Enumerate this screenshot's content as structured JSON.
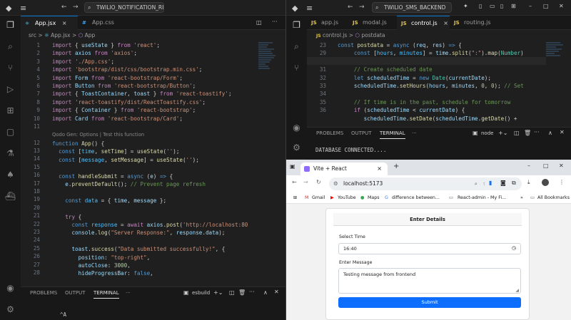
{
  "left_window": {
    "search": "TWILIO_NOTIFICATION_RIMINDER",
    "tabs": [
      {
        "icon": "⚛",
        "label": "App.jsx",
        "close": "×"
      },
      {
        "icon": "#",
        "label": "App.css",
        "close": ""
      }
    ],
    "breadcrumb": {
      "folder": "src",
      "sep": ">",
      "file": "App.jsx",
      "symbol": "App"
    },
    "codelens": "Qodo Gen: Options | Test this function",
    "line_numbers": [
      "1",
      "2",
      "3",
      "4",
      "5",
      "6",
      "7",
      "8",
      "9",
      "10",
      "11",
      "",
      "12",
      "13",
      "14",
      "15",
      "16",
      "17",
      "18",
      "19",
      "20",
      "21",
      "22",
      "23",
      "24",
      "25",
      "26",
      "27",
      "28"
    ],
    "panel": {
      "tabs": [
        "PROBLEMS",
        "OUTPUT",
        "TERMINAL",
        "···"
      ],
      "terminal_name": "esbuild",
      "terminal_text": "^A"
    }
  },
  "right_window": {
    "search": "TWILIO_SMS_BACKEND",
    "tabs": [
      {
        "icon": "JS",
        "label": "app.js"
      },
      {
        "icon": "JS",
        "label": "modal.js"
      },
      {
        "icon": "JS",
        "label": "control.js",
        "close": "×"
      },
      {
        "icon": "JS",
        "label": "routing.js"
      }
    ],
    "breadcrumb": {
      "file": "control.js",
      "sep": ">",
      "symbol": "postdata"
    },
    "line_numbers": [
      "23",
      "29",
      "30",
      "31",
      "32",
      "33",
      "34",
      "35",
      "36"
    ],
    "panel": {
      "tabs": [
        "PROBLEMS",
        "OUTPUT",
        "TERMINAL",
        "···"
      ],
      "terminal_name": "node",
      "terminal_text": "DATABASE CONNECTED...."
    }
  },
  "browser": {
    "tab_title": "Vite + React",
    "tab_close": "×",
    "new_tab": "+",
    "url": "localhost:5173",
    "bookmarks": [
      "Gmail",
      "YouTube",
      "Maps",
      "difference between...",
      "React-admin - My Fi...",
      "All Bookmarks"
    ],
    "form": {
      "title": "Enter Details",
      "time_label": "Select Time",
      "time_value": "16:40",
      "message_label": "Enter Message",
      "message_value": "Testing message from frontend",
      "submit_label": "Submit"
    }
  }
}
